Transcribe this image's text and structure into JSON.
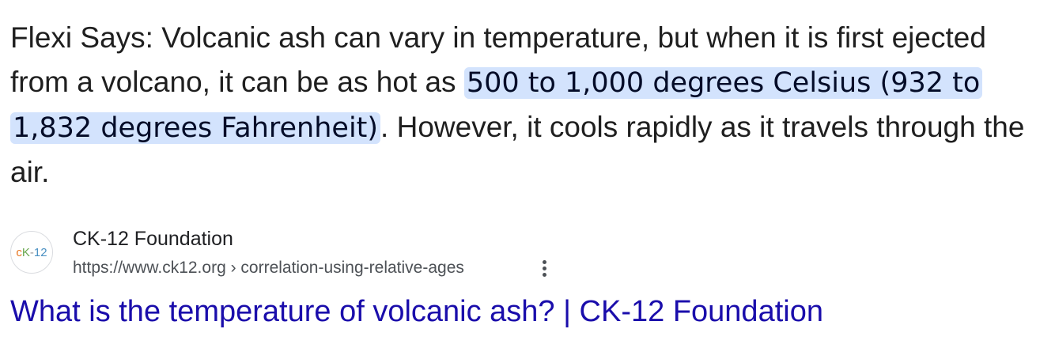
{
  "snippet": {
    "before": "Flexi Says: Volcanic ash can vary in temperature, but when it is first ejected from a volcano, it can be as hot as ",
    "highlight": "500 to 1,000 degrees Celsius (932 to 1,832 degrees Fahrenheit)",
    "after": ". However, it cools rapidly as it travels through the air."
  },
  "source": {
    "favicon_text": {
      "c": "c",
      "k": "K",
      "dash": "-",
      "num": "12"
    },
    "site_name": "CK-12 Foundation",
    "url": "https://www.ck12.org › correlation-using-relative-ages",
    "more_icon": "vertical-dots-icon"
  },
  "result": {
    "title": "What is the temperature of volcanic ash? | CK-12 Foundation"
  },
  "colors": {
    "highlight_bg": "#d3e3fd",
    "link": "#1a0dab",
    "text": "#1f1f1f",
    "url": "#4d5156"
  }
}
